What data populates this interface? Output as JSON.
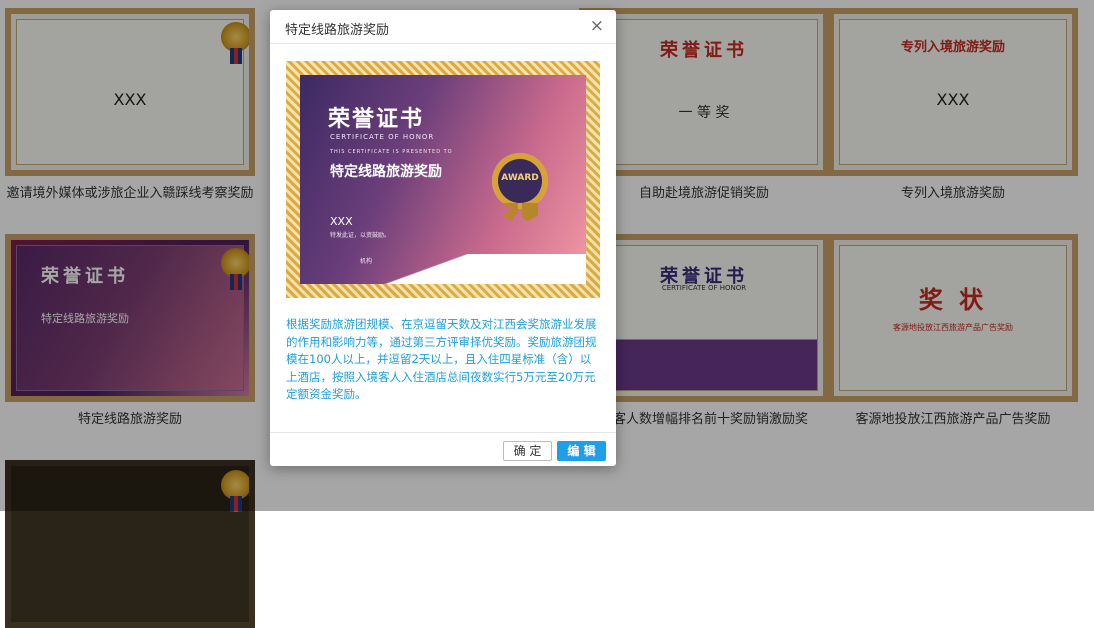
{
  "cards": [
    {
      "caption": "邀请境外媒体或涉旅企业入赣踩线考察奖励",
      "xxx": "XXX"
    },
    {
      "caption": "自助赴境旅游促销奖励",
      "head": "荣誉证书",
      "sub": "一 等 奖"
    },
    {
      "caption": "专列入境旅游奖励",
      "head": "专列入境旅游奖励",
      "xxx": "XXX"
    },
    {
      "caption": "特定线路旅游奖励",
      "head": "荣誉证书",
      "sub": "特定线路旅游奖励"
    },
    {
      "caption": "游客人数增幅排名前十奖励销激励奖",
      "head": "荣誉证书",
      "sub": "CERTIFICATE OF HONOR"
    },
    {
      "caption": "客源地投放江西旅游产品广告奖励",
      "head": "奖 状",
      "sub": "客源地投放江西旅游产品广告奖励"
    }
  ],
  "modal": {
    "title": "特定线路旅游奖励",
    "close_glyph": "×",
    "certificate": {
      "title": "荣誉证书",
      "en_title": "CERTIFICATE OF HONOR",
      "en_line": "THIS CERTIFICATE IS PRESENTED TO",
      "award_name": "特定线路旅游奖励",
      "seal_text": "AWARD",
      "recipient": "XXX",
      "sub_text": "特发此证，以资鼓励。",
      "sign": "机构"
    },
    "description": "根据奖励旅游团规模、在京逗留天数及对江西会奖旅游业发展的作用和影响力等，通过第三方评审择优奖励。奖励旅游团规模在100人以上，并逗留2天以上，且入住四星标准（含）以上酒店，按照入境客人入住酒店总间夜数实行5万元至20万元定额资金奖励。",
    "ok_label": "确 定",
    "edit_label": "编 辑"
  }
}
